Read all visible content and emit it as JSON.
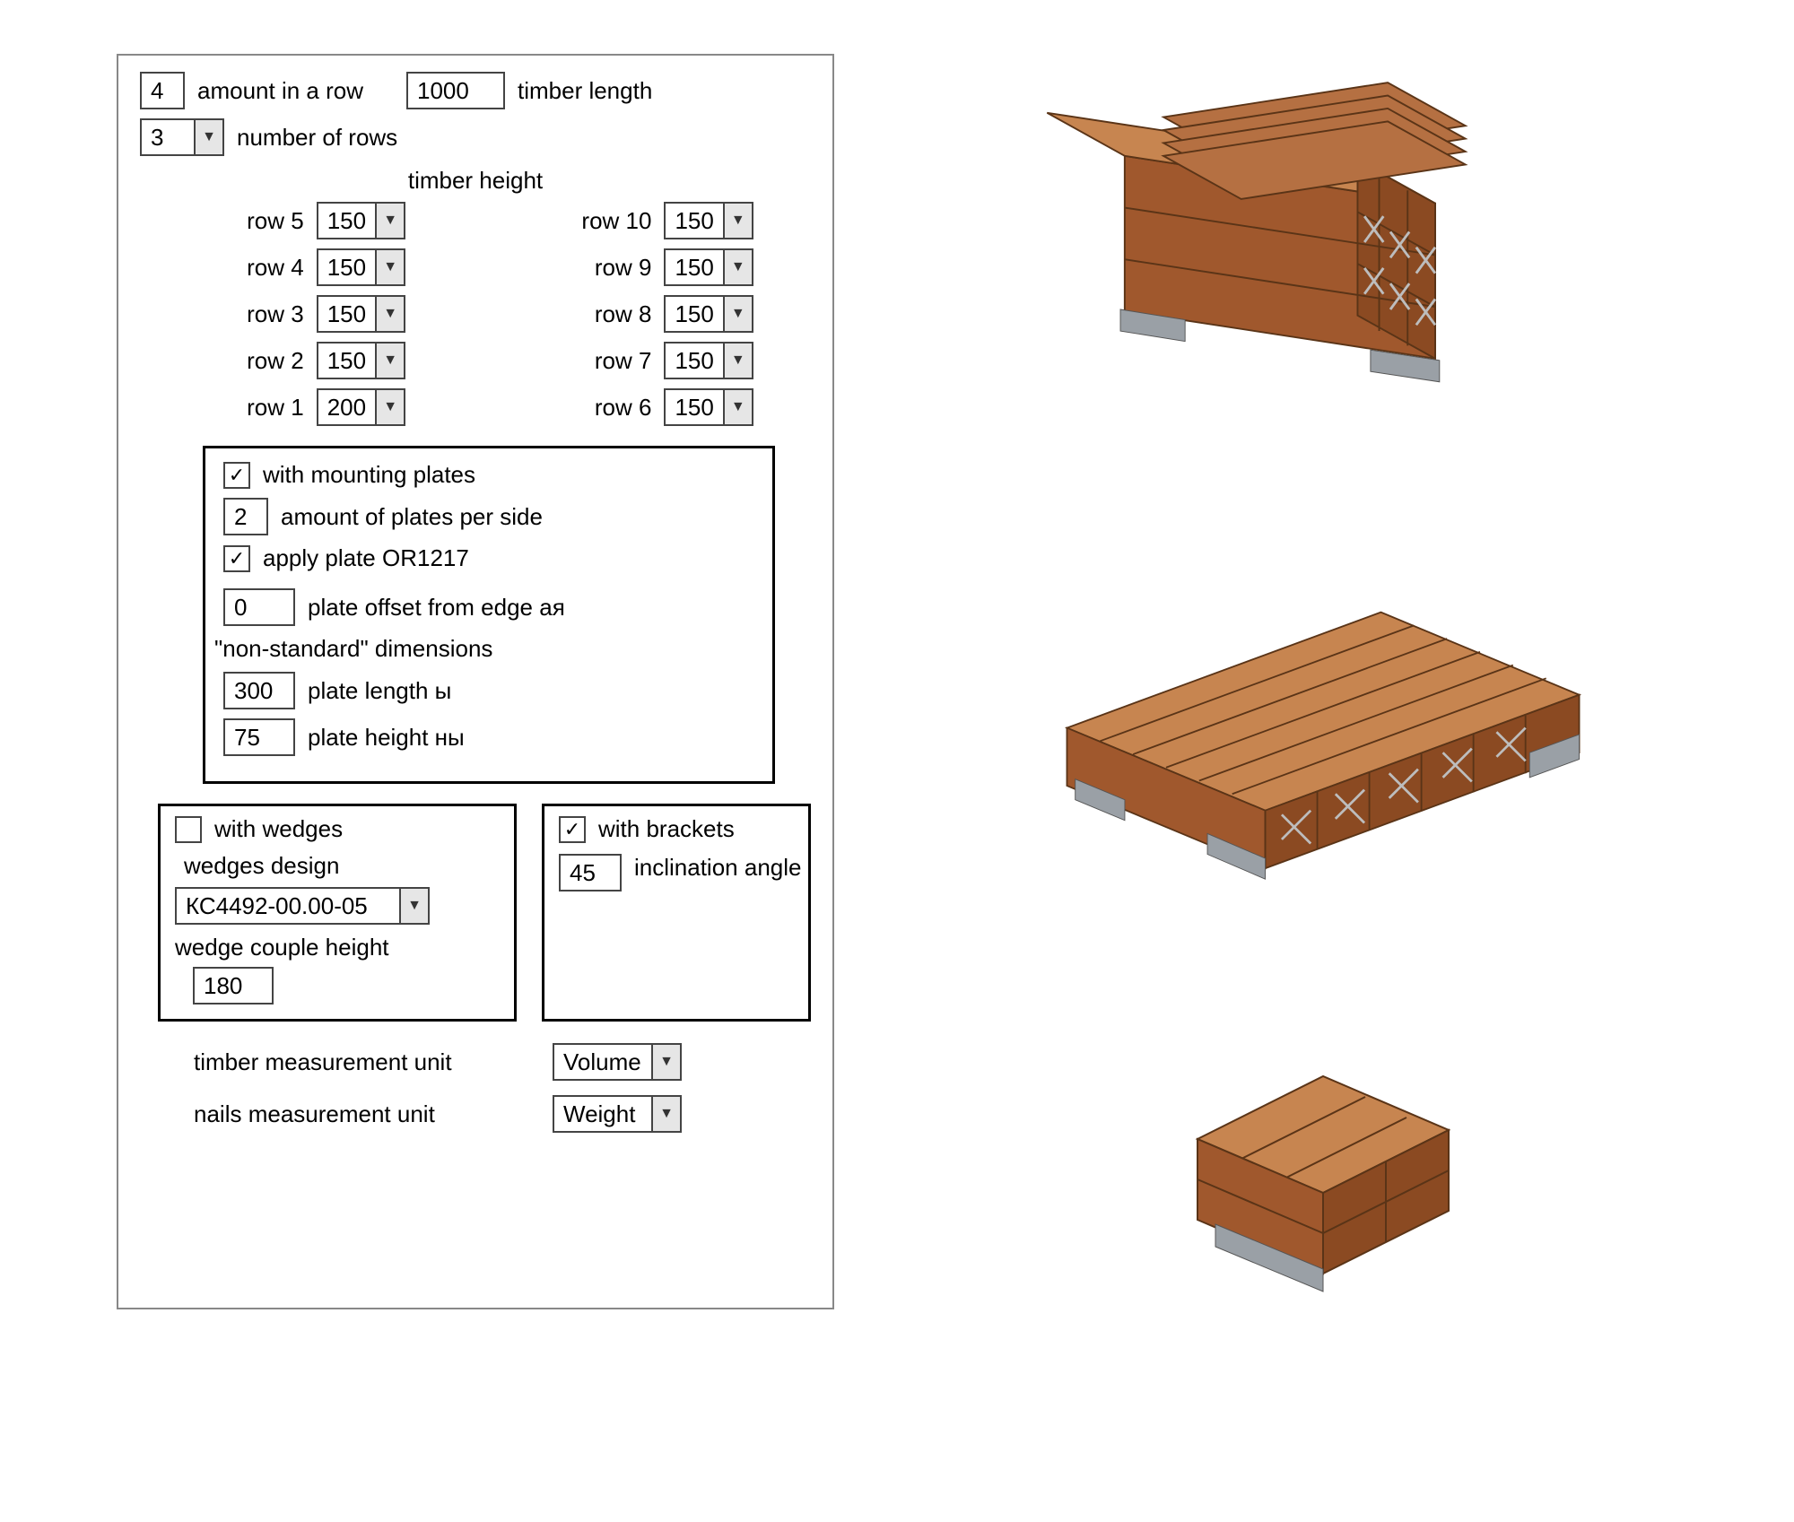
{
  "amount_in_row": "4",
  "amount_in_row_label": "amount in a row",
  "timber_length": "1000",
  "timber_length_label": "timber length",
  "number_of_rows": "3",
  "number_of_rows_label": "number of rows",
  "timber_height_label": "timber height",
  "rows_left": [
    {
      "label": "row 5",
      "value": "150"
    },
    {
      "label": "row 4",
      "value": "150"
    },
    {
      "label": "row 3",
      "value": "150"
    },
    {
      "label": "row 2",
      "value": "150"
    },
    {
      "label": "row 1",
      "value": "200"
    }
  ],
  "rows_right": [
    {
      "label": "row 10",
      "value": "150"
    },
    {
      "label": "row 9",
      "value": "150"
    },
    {
      "label": "row 8",
      "value": "150"
    },
    {
      "label": "row 7",
      "value": "150"
    },
    {
      "label": "row 6",
      "value": "150"
    }
  ],
  "plates": {
    "with_label": "with mounting plates",
    "amount_label": "amount of plates per side",
    "amount": "2",
    "apply_label": "apply plate OR1217",
    "offset": "0",
    "offset_label": "plate offset from edge ая",
    "nonstd_label": "\"non-standard\" dimensions",
    "length": "300",
    "length_label": "plate length  ы",
    "height": "75",
    "height_label": "plate height  ны"
  },
  "wedges": {
    "with_label": "with wedges",
    "design_label": "wedges design",
    "design": "КС4492-00.00-05",
    "couple_label": "wedge couple height",
    "couple": "180"
  },
  "brackets": {
    "with_label": "with brackets",
    "angle_label": "inclination angle",
    "angle": "45"
  },
  "mu": {
    "timber_label": "timber measurement unit",
    "timber": "Volume",
    "nails_label": "nails measurement unit",
    "nails": "Weight"
  }
}
